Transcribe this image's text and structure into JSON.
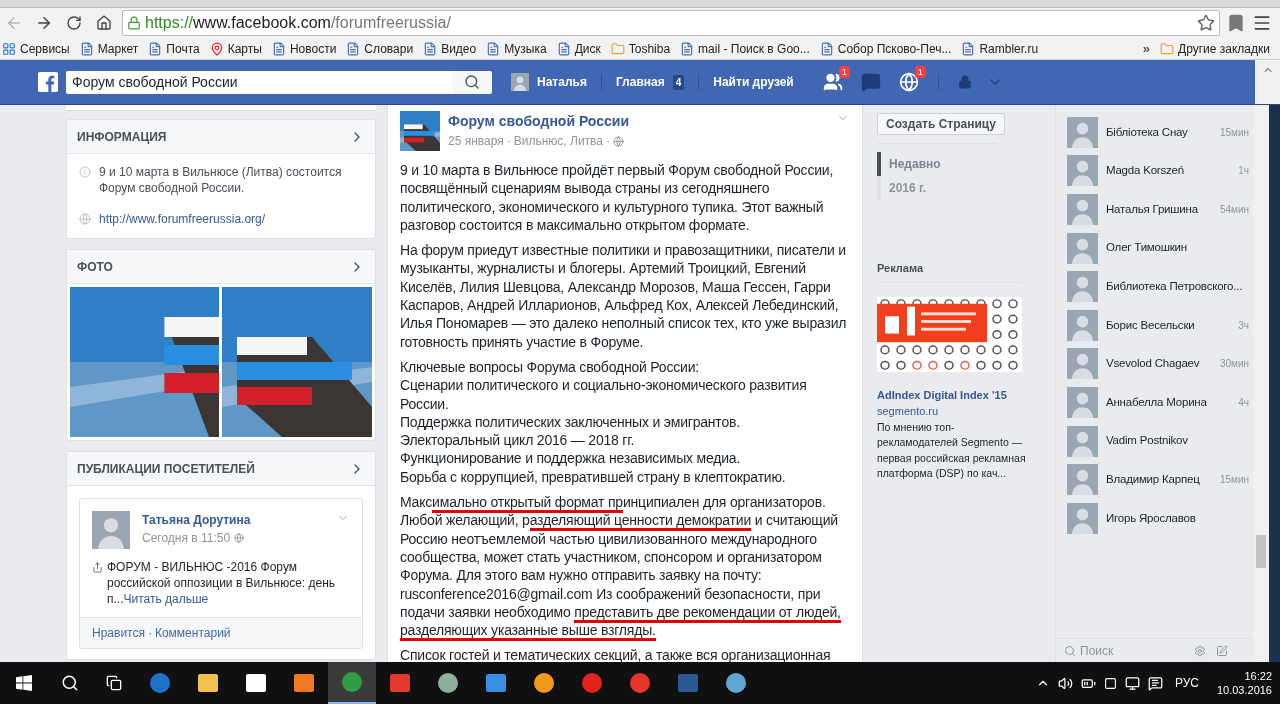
{
  "browser": {
    "back": {
      "disabled": true
    },
    "forward": {
      "disabled": false
    },
    "address": {
      "scheme": "https://",
      "host": "www.facebook.com",
      "path": "/forumfreerussia/"
    },
    "bookmarks": [
      {
        "label": "Сервисы",
        "kind": "apps"
      },
      {
        "label": "Маркет",
        "kind": "site"
      },
      {
        "label": "Почта",
        "kind": "site"
      },
      {
        "label": "Карты",
        "kind": "pin"
      },
      {
        "label": "Новости",
        "kind": "site"
      },
      {
        "label": "Словари",
        "kind": "site"
      },
      {
        "label": "Видео",
        "kind": "site"
      },
      {
        "label": "Музыка",
        "kind": "site"
      },
      {
        "label": "Диск",
        "kind": "site"
      },
      {
        "label": "Toshiba",
        "kind": "folder"
      },
      {
        "label": "mail - Поиск в Goo...",
        "kind": "site"
      },
      {
        "label": "Собор Псково-Печ...",
        "kind": "site"
      },
      {
        "label": "Rambler.ru",
        "kind": "site"
      }
    ],
    "overflow": "»",
    "other_bookmarks": "Другие закладки"
  },
  "topbar": {
    "search_value": "Форум свободной России",
    "user": "Наталья",
    "home": "Главная",
    "home_count": "4",
    "find_friends": "Найти друзей",
    "friend_badge": "1",
    "globe_badge": "1"
  },
  "left": {
    "info": {
      "title": "ИНФОРМАЦИЯ",
      "about": "9 и 10 марта в Вильнюсе (Литва) состоится Форум свободной России.",
      "website": "http://www.forumfreerussia.org/"
    },
    "photos": {
      "title": "ФОТО"
    },
    "visitor_posts": {
      "title": "ПУБЛИКАЦИИ ПОСЕТИТЕЛЕЙ",
      "author": "Татьяна Дорутина",
      "time": "Сегодня в 11:50",
      "text": "ФОРУМ - ВИЛЬНЮС -2016 Форум российской оппозиции в Вильнюсе: день п...",
      "read_more": "Читать дальше",
      "like": "Нравится",
      "separator": "·",
      "comment": "Комментарий"
    }
  },
  "post": {
    "page": "Форум свободной России",
    "date": "25 января",
    "separator": "·",
    "place": "Вильнюс, Литва",
    "paragraphs": [
      {
        "segments": [
          {
            "text": "9 и 10 марта в Вильнюсе пройдёт первый Форум свободной России, посвящённый сценариям вывода страны из сегодняшнего политического, экономического и культурного тупика. Этот важный разговор состоится в максимально открытом формате.",
            "underlined": false
          }
        ]
      },
      {
        "segments": [
          {
            "text": "На форум приедут известные политики и правозащитники, писатели и музыканты, журналисты и блогеры. Артемий Троицкий, Евгений Киселёв, Лилия Шевцова, Александр Морозов, Маша Гессен, Гарри Каспаров, Андрей Илларионов, Альфред Кох, Алексей Лебединский, Илья Пономарев — это далеко неполный список тех, кто уже выразил готовность принять участие в Форуме.",
            "underlined": false
          }
        ]
      },
      {
        "lines": [
          "Ключевые вопросы Форума свободной России:",
          "Сценарии политического и социально-экономического развития России.",
          "Поддержка политических заключенных и эмигрантов.",
          "Электоральный цикл 2016 — 2018 гг.",
          "Функционирование и поддержка независимых медиа.",
          "Борьба с коррупцией, превратившей страну в клептократию."
        ]
      },
      {
        "segments": [
          {
            "text": "Макс",
            "underlined": false
          },
          {
            "text": "имально открытый формат пр",
            "underlined": true
          },
          {
            "text": "инципиален для организаторов. Любой желающий, р",
            "underlined": false
          },
          {
            "text": "азделяющий ценности демократии",
            "underlined": true
          },
          {
            "text": " и считающий Россию неотъемлемой частью цивилизованного международного сообщества, может стать участником, спонсором и организатором Форума. Для этого вам нужно отправить заявку на почту: rusconference2016@gmail.com Из соображений безопасности, при подачи заявки необходимо ",
            "underlined": false
          },
          {
            "text": "представить две рекомендации от людей, разделяющих указанные выше взгляды.",
            "underlined": true
          }
        ]
      },
      {
        "text": "Список гостей и тематических секций, а также вся организационная"
      }
    ]
  },
  "right": {
    "create_page": "Создать Страницу",
    "timeline": [
      {
        "label": "Недавно",
        "selected": true
      },
      {
        "label": "2016 г.",
        "selected": false
      }
    ],
    "ads_title": "Реклама",
    "ad": {
      "title": "AdIndex Digital Index '15",
      "domain": "segmento.ru",
      "text": "По мнению топ-рекламодателей Segmento — первая российская рекламная платформа (DSP) по кач..."
    }
  },
  "chat": {
    "contacts": [
      {
        "name": "Бібліотека Снау",
        "time": "15мин"
      },
      {
        "name": "Magda Korszeń",
        "time": "1ч"
      },
      {
        "name": "Наталья Гришина",
        "time": "54мин"
      },
      {
        "name": "Олег Тимошкин"
      },
      {
        "name": "Библиотека Петровского..."
      },
      {
        "name": "Борис Весельски",
        "time": "3ч"
      },
      {
        "name": "Vsevolod Chagaev",
        "time": "30мин"
      },
      {
        "name": "Аннабелла Морина",
        "time": "4ч"
      },
      {
        "name": "Vadim Postnikov"
      },
      {
        "name": "Владимир Карпец",
        "time": "15мин"
      },
      {
        "name": "Игорь Ярославов"
      }
    ],
    "search_placeholder": "Поиск"
  },
  "taskbar": {
    "apps": [
      {
        "kind": "edge",
        "color": "#1e73c8",
        "selected": false
      },
      {
        "kind": "folder",
        "color": "#f2c14e",
        "selected": false
      },
      {
        "kind": "store",
        "color": "#ffffff",
        "selected": false
      },
      {
        "kind": "media",
        "color": "#f07b22",
        "selected": false
      },
      {
        "kind": "chrome",
        "color": "#2e9e44",
        "selected": true
      },
      {
        "kind": "yandex",
        "color": "#e23a2e",
        "selected": false
      },
      {
        "kind": "disc",
        "color": "#8fae9a",
        "selected": false
      },
      {
        "kind": "mail",
        "color": "#3a8ee6",
        "selected": false
      },
      {
        "kind": "ok",
        "color": "#f39a1d",
        "selected": false
      },
      {
        "kind": "opera",
        "color": "#e0221b",
        "selected": false
      },
      {
        "kind": "yabrowser",
        "color": "#e8332a",
        "selected": false
      },
      {
        "kind": "word",
        "color": "#2b5797",
        "selected": false
      },
      {
        "kind": "paint",
        "color": "#5fa8d3",
        "selected": false
      }
    ],
    "language": "РУС",
    "time": "16:22",
    "date": "10.03.2016"
  }
}
